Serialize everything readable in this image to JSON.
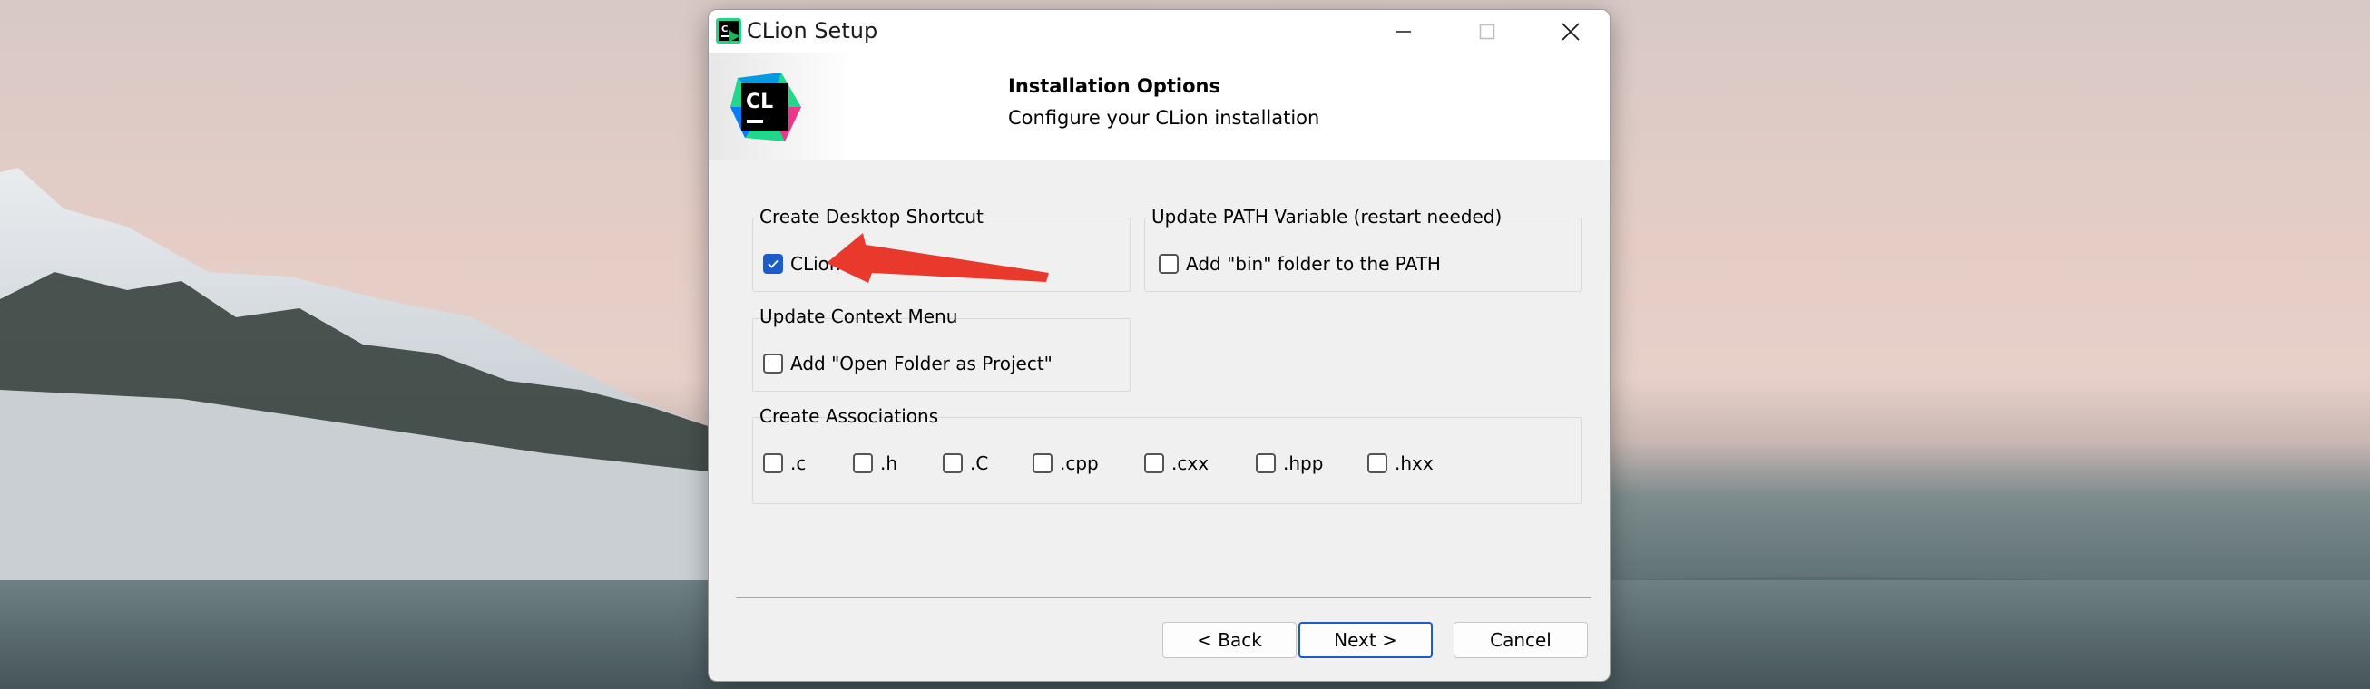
{
  "window": {
    "title": "CLion Setup",
    "icon_name": "clion-app-icon"
  },
  "controls": {
    "minimize_icon": "minimize-icon",
    "maximize_icon": "maximize-icon",
    "close_icon": "close-icon"
  },
  "header": {
    "logo_text": "CL",
    "title": "Installation Options",
    "subtitle": "Configure your CLion installation"
  },
  "groups": {
    "desktop_shortcut": {
      "label": "Create Desktop Shortcut",
      "option": {
        "label": "CLion",
        "checked": true
      }
    },
    "path_variable": {
      "label": "Update PATH Variable (restart needed)",
      "option": {
        "label": "Add \"bin\" folder to the PATH",
        "checked": false
      }
    },
    "context_menu": {
      "label": "Update Context Menu",
      "option": {
        "label": "Add \"Open Folder as Project\"",
        "checked": false
      }
    },
    "associations": {
      "label": "Create Associations",
      "options": [
        {
          "label": ".c",
          "checked": false
        },
        {
          "label": ".h",
          "checked": false
        },
        {
          "label": ".C",
          "checked": false
        },
        {
          "label": ".cpp",
          "checked": false
        },
        {
          "label": ".cxx",
          "checked": false
        },
        {
          "label": ".hpp",
          "checked": false
        },
        {
          "label": ".hxx",
          "checked": false
        }
      ]
    }
  },
  "buttons": {
    "back": "< Back",
    "next": "Next >",
    "cancel": "Cancel"
  },
  "annotation": {
    "color": "#e8392c",
    "icon_name": "red-arrow-annotation"
  },
  "accent_color": "#1c5cc8"
}
